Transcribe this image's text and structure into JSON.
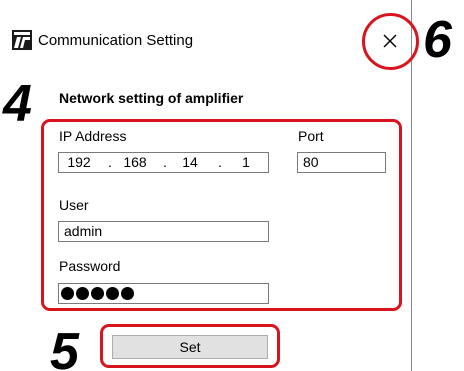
{
  "window": {
    "title": "Communication Setting",
    "close_glyph": "×"
  },
  "group": {
    "title": "Network setting of amplifier"
  },
  "ip": {
    "label": "IP Address",
    "octets": [
      "192",
      "168",
      "14",
      "1"
    ],
    "separator": "."
  },
  "port": {
    "label": "Port",
    "value": "80"
  },
  "user": {
    "label": "User",
    "value": "admin"
  },
  "password": {
    "label": "Password",
    "masked_length": 5
  },
  "set_button": {
    "label": "Set"
  },
  "annotations": {
    "step_4": "4",
    "step_5": "5",
    "step_6": "6",
    "color": "#d8141e"
  },
  "icons": {
    "app": "app-logo-icon",
    "close": "close-icon"
  }
}
